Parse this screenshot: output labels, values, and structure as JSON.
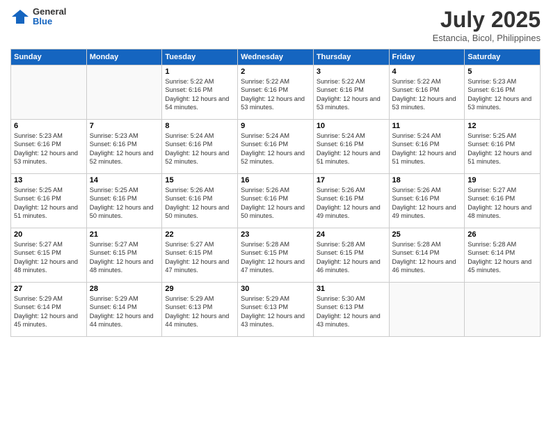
{
  "header": {
    "logo_general": "General",
    "logo_blue": "Blue",
    "month_title": "July 2025",
    "location": "Estancia, Bicol, Philippines"
  },
  "weekdays": [
    "Sunday",
    "Monday",
    "Tuesday",
    "Wednesday",
    "Thursday",
    "Friday",
    "Saturday"
  ],
  "weeks": [
    [
      {
        "day": "",
        "sunrise": "",
        "sunset": "",
        "daylight": ""
      },
      {
        "day": "",
        "sunrise": "",
        "sunset": "",
        "daylight": ""
      },
      {
        "day": "1",
        "sunrise": "Sunrise: 5:22 AM",
        "sunset": "Sunset: 6:16 PM",
        "daylight": "Daylight: 12 hours and 54 minutes."
      },
      {
        "day": "2",
        "sunrise": "Sunrise: 5:22 AM",
        "sunset": "Sunset: 6:16 PM",
        "daylight": "Daylight: 12 hours and 53 minutes."
      },
      {
        "day": "3",
        "sunrise": "Sunrise: 5:22 AM",
        "sunset": "Sunset: 6:16 PM",
        "daylight": "Daylight: 12 hours and 53 minutes."
      },
      {
        "day": "4",
        "sunrise": "Sunrise: 5:22 AM",
        "sunset": "Sunset: 6:16 PM",
        "daylight": "Daylight: 12 hours and 53 minutes."
      },
      {
        "day": "5",
        "sunrise": "Sunrise: 5:23 AM",
        "sunset": "Sunset: 6:16 PM",
        "daylight": "Daylight: 12 hours and 53 minutes."
      }
    ],
    [
      {
        "day": "6",
        "sunrise": "Sunrise: 5:23 AM",
        "sunset": "Sunset: 6:16 PM",
        "daylight": "Daylight: 12 hours and 53 minutes."
      },
      {
        "day": "7",
        "sunrise": "Sunrise: 5:23 AM",
        "sunset": "Sunset: 6:16 PM",
        "daylight": "Daylight: 12 hours and 52 minutes."
      },
      {
        "day": "8",
        "sunrise": "Sunrise: 5:24 AM",
        "sunset": "Sunset: 6:16 PM",
        "daylight": "Daylight: 12 hours and 52 minutes."
      },
      {
        "day": "9",
        "sunrise": "Sunrise: 5:24 AM",
        "sunset": "Sunset: 6:16 PM",
        "daylight": "Daylight: 12 hours and 52 minutes."
      },
      {
        "day": "10",
        "sunrise": "Sunrise: 5:24 AM",
        "sunset": "Sunset: 6:16 PM",
        "daylight": "Daylight: 12 hours and 51 minutes."
      },
      {
        "day": "11",
        "sunrise": "Sunrise: 5:24 AM",
        "sunset": "Sunset: 6:16 PM",
        "daylight": "Daylight: 12 hours and 51 minutes."
      },
      {
        "day": "12",
        "sunrise": "Sunrise: 5:25 AM",
        "sunset": "Sunset: 6:16 PM",
        "daylight": "Daylight: 12 hours and 51 minutes."
      }
    ],
    [
      {
        "day": "13",
        "sunrise": "Sunrise: 5:25 AM",
        "sunset": "Sunset: 6:16 PM",
        "daylight": "Daylight: 12 hours and 51 minutes."
      },
      {
        "day": "14",
        "sunrise": "Sunrise: 5:25 AM",
        "sunset": "Sunset: 6:16 PM",
        "daylight": "Daylight: 12 hours and 50 minutes."
      },
      {
        "day": "15",
        "sunrise": "Sunrise: 5:26 AM",
        "sunset": "Sunset: 6:16 PM",
        "daylight": "Daylight: 12 hours and 50 minutes."
      },
      {
        "day": "16",
        "sunrise": "Sunrise: 5:26 AM",
        "sunset": "Sunset: 6:16 PM",
        "daylight": "Daylight: 12 hours and 50 minutes."
      },
      {
        "day": "17",
        "sunrise": "Sunrise: 5:26 AM",
        "sunset": "Sunset: 6:16 PM",
        "daylight": "Daylight: 12 hours and 49 minutes."
      },
      {
        "day": "18",
        "sunrise": "Sunrise: 5:26 AM",
        "sunset": "Sunset: 6:16 PM",
        "daylight": "Daylight: 12 hours and 49 minutes."
      },
      {
        "day": "19",
        "sunrise": "Sunrise: 5:27 AM",
        "sunset": "Sunset: 6:16 PM",
        "daylight": "Daylight: 12 hours and 48 minutes."
      }
    ],
    [
      {
        "day": "20",
        "sunrise": "Sunrise: 5:27 AM",
        "sunset": "Sunset: 6:15 PM",
        "daylight": "Daylight: 12 hours and 48 minutes."
      },
      {
        "day": "21",
        "sunrise": "Sunrise: 5:27 AM",
        "sunset": "Sunset: 6:15 PM",
        "daylight": "Daylight: 12 hours and 48 minutes."
      },
      {
        "day": "22",
        "sunrise": "Sunrise: 5:27 AM",
        "sunset": "Sunset: 6:15 PM",
        "daylight": "Daylight: 12 hours and 47 minutes."
      },
      {
        "day": "23",
        "sunrise": "Sunrise: 5:28 AM",
        "sunset": "Sunset: 6:15 PM",
        "daylight": "Daylight: 12 hours and 47 minutes."
      },
      {
        "day": "24",
        "sunrise": "Sunrise: 5:28 AM",
        "sunset": "Sunset: 6:15 PM",
        "daylight": "Daylight: 12 hours and 46 minutes."
      },
      {
        "day": "25",
        "sunrise": "Sunrise: 5:28 AM",
        "sunset": "Sunset: 6:14 PM",
        "daylight": "Daylight: 12 hours and 46 minutes."
      },
      {
        "day": "26",
        "sunrise": "Sunrise: 5:28 AM",
        "sunset": "Sunset: 6:14 PM",
        "daylight": "Daylight: 12 hours and 45 minutes."
      }
    ],
    [
      {
        "day": "27",
        "sunrise": "Sunrise: 5:29 AM",
        "sunset": "Sunset: 6:14 PM",
        "daylight": "Daylight: 12 hours and 45 minutes."
      },
      {
        "day": "28",
        "sunrise": "Sunrise: 5:29 AM",
        "sunset": "Sunset: 6:14 PM",
        "daylight": "Daylight: 12 hours and 44 minutes."
      },
      {
        "day": "29",
        "sunrise": "Sunrise: 5:29 AM",
        "sunset": "Sunset: 6:13 PM",
        "daylight": "Daylight: 12 hours and 44 minutes."
      },
      {
        "day": "30",
        "sunrise": "Sunrise: 5:29 AM",
        "sunset": "Sunset: 6:13 PM",
        "daylight": "Daylight: 12 hours and 43 minutes."
      },
      {
        "day": "31",
        "sunrise": "Sunrise: 5:30 AM",
        "sunset": "Sunset: 6:13 PM",
        "daylight": "Daylight: 12 hours and 43 minutes."
      },
      {
        "day": "",
        "sunrise": "",
        "sunset": "",
        "daylight": ""
      },
      {
        "day": "",
        "sunrise": "",
        "sunset": "",
        "daylight": ""
      }
    ]
  ]
}
